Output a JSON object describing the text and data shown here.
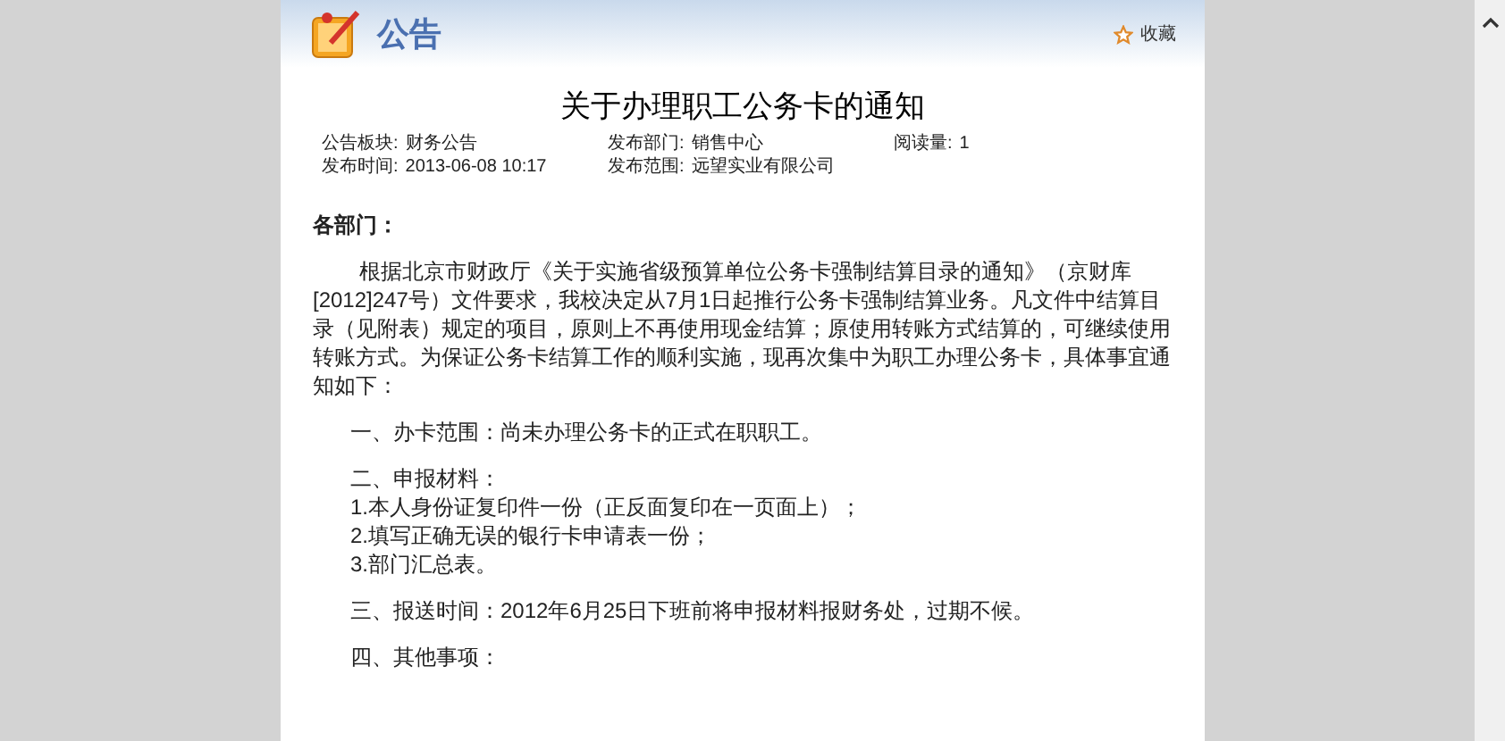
{
  "header": {
    "title": "公告",
    "favorite": "收藏"
  },
  "notice": {
    "title": "关于办理职工公务卡的通知",
    "meta": [
      {
        "label": "公告板块:",
        "value": "财务公告"
      },
      {
        "label": "发布部门:",
        "value": "销售中心"
      },
      {
        "label": "阅读量:",
        "value": "1"
      },
      {
        "label": "发布时间:",
        "value": "2013-06-08 10:17"
      },
      {
        "label": "发布范围:",
        "value": "远望实业有限公司"
      }
    ],
    "salutation": "各部门：",
    "paragraphs": [
      {
        "kind": "indent",
        "lines": [
          "根据北京市财政厅《关于实施省级预算单位公务卡强制结算目录的通知》（京财库[2012]247号）文件要求，我校决定从7月1日起推行公务卡强制结算业务。凡文件中结算目录（见附表）规定的项目，原则上不再使用现金结算；原使用转账方式结算的，可继续使用转账方式。为保证公务卡结算工作的顺利实施，现再次集中为职工办理公务卡，具体事宜通知如下："
        ]
      },
      {
        "kind": "block",
        "lines": [
          "一、办卡范围：尚未办理公务卡的正式在职职工。"
        ]
      },
      {
        "kind": "block",
        "lines": [
          "二、申报材料：",
          "1.本人身份证复印件一份（正反面复印在一页面上）；",
          "2.填写正确无误的银行卡申请表一份；",
          "3.部门汇总表。"
        ]
      },
      {
        "kind": "block",
        "lines": [
          "三、报送时间：2012年6月25日下班前将申报材料报财务处，过期不候。"
        ]
      },
      {
        "kind": "block",
        "lines": [
          "四、其他事项："
        ]
      }
    ]
  }
}
